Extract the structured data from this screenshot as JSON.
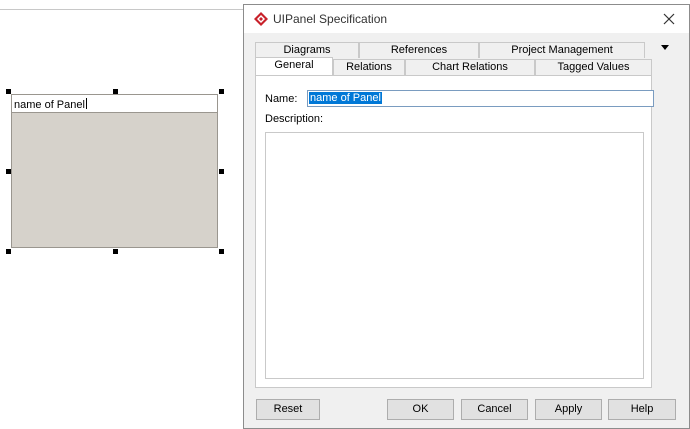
{
  "canvas": {
    "panel": {
      "name_text": "name of Panel"
    }
  },
  "dialog": {
    "title": "UIPanel Specification",
    "icons": {
      "app": "diamond-app-icon",
      "close": "close-icon",
      "tabs_menu": "triangle-down-icon"
    },
    "tabs_back_row": [
      "Diagrams",
      "References",
      "Project Management"
    ],
    "tabs_front_row": [
      "General",
      "Relations",
      "Chart Relations",
      "Tagged Values"
    ],
    "selected_tab": "General",
    "general": {
      "name_label": "Name:",
      "name_value": "name of Panel",
      "description_label": "Description:",
      "description_value": ""
    },
    "buttons": {
      "reset": "Reset",
      "ok": "OK",
      "cancel": "Cancel",
      "apply": "Apply",
      "help": "Help"
    }
  },
  "colors": {
    "panel_fill": "#d6d2cb",
    "selection": "#0078d7",
    "icon_red": "#c8202a"
  }
}
